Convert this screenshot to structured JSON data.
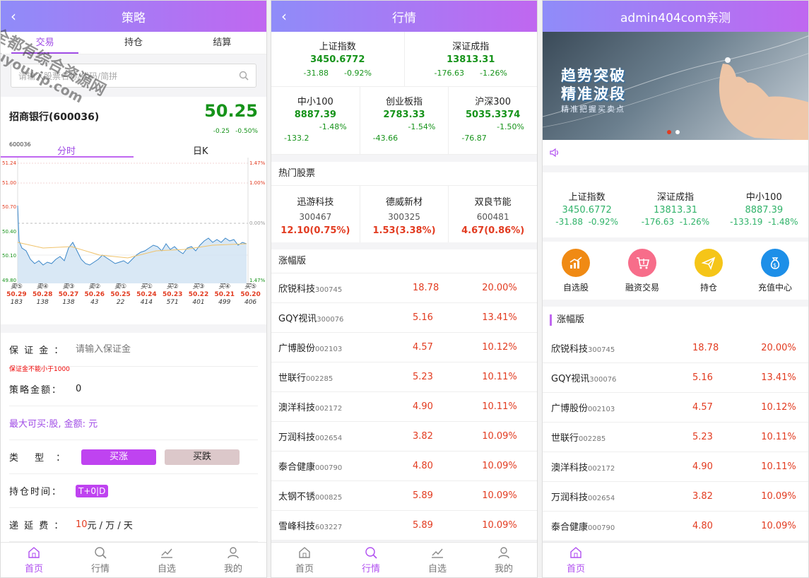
{
  "p1": {
    "title": "策略",
    "tabs": [
      "交易",
      "持仓",
      "结算"
    ],
    "search_placeholder": "请输入股票名称/代码/简拼",
    "stock": {
      "name": "招商银行(600036)",
      "price": "50.25",
      "change": "-0.25",
      "pct": "-0.50%",
      "code": "600036"
    },
    "subtabs": [
      "分时",
      "日K"
    ],
    "y_labels_left": [
      "51.24",
      "51.00",
      "50.70",
      "50.40",
      "50.10",
      "49.80"
    ],
    "y_labels_right": [
      "1.47%",
      "1.00%",
      "0.00%",
      "1.47%"
    ],
    "orders": [
      {
        "label": "卖⑤",
        "price": "50.29",
        "vol": "183"
      },
      {
        "label": "卖④",
        "price": "50.28",
        "vol": "138"
      },
      {
        "label": "卖③",
        "price": "50.27",
        "vol": "138"
      },
      {
        "label": "卖②",
        "price": "50.26",
        "vol": "43"
      },
      {
        "label": "卖①",
        "price": "50.25",
        "vol": "22"
      },
      {
        "label": "买①",
        "price": "50.24",
        "vol": "414"
      },
      {
        "label": "买②",
        "price": "50.23",
        "vol": "571"
      },
      {
        "label": "买③",
        "price": "50.22",
        "vol": "401"
      },
      {
        "label": "买④",
        "price": "50.21",
        "vol": "499"
      },
      {
        "label": "买⑤",
        "price": "50.20",
        "vol": "406"
      }
    ],
    "form": {
      "margin_label": "保 证 金 ：",
      "margin_placeholder": "请输入保证金",
      "margin_hint": "保证金不能小于1000",
      "amount_label": "策略金额：",
      "amount_value": "0",
      "max_buy": "最大可买:股, 金额: 元",
      "type_label": "类　 型　：",
      "btn_up": "买涨",
      "btn_down": "买跌",
      "hold_label": "持仓时间：",
      "hold_value": "T+0|D",
      "fee_label": "递 延 费 ：",
      "fee_value": "10",
      "fee_unit": "元 / 万 / 天"
    }
  },
  "p2": {
    "title": "行情",
    "indices_top": [
      {
        "name": "上证指数",
        "value": "3450.6772",
        "chg": "-31.88",
        "pct": "-0.92%"
      },
      {
        "name": "深证成指",
        "value": "13813.31",
        "chg": "-176.63",
        "pct": "-1.26%"
      }
    ],
    "indices_mid": [
      {
        "name": "中小100",
        "value": "8887.39",
        "pct": "-1.48%",
        "chg": "-133.2"
      },
      {
        "name": "创业板指",
        "value": "2783.33",
        "pct": "-1.54%",
        "chg": "-43.66"
      },
      {
        "name": "沪深300",
        "value": "5035.3374",
        "pct": "-1.50%",
        "chg": "-76.87"
      }
    ],
    "hot_title": "热门股票",
    "hot": [
      {
        "name": "迅游科技",
        "code": "300467",
        "val": "12.10(0.75%)"
      },
      {
        "name": "德威新材",
        "code": "300325",
        "val": "1.53(3.38%)"
      },
      {
        "name": "双良节能",
        "code": "600481",
        "val": "4.67(0.86%)"
      }
    ],
    "list_title": "涨幅版",
    "list": [
      {
        "name": "欣锐科技",
        "code": "300745",
        "price": "18.78",
        "pct": "20.00%"
      },
      {
        "name": "GQY视讯",
        "code": "300076",
        "price": "5.16",
        "pct": "13.41%"
      },
      {
        "name": "广博股份",
        "code": "002103",
        "price": "4.57",
        "pct": "10.12%"
      },
      {
        "name": "世联行",
        "code": "002285",
        "price": "5.23",
        "pct": "10.11%"
      },
      {
        "name": "澳洋科技",
        "code": "002172",
        "price": "4.90",
        "pct": "10.11%"
      },
      {
        "name": "万润科技",
        "code": "002654",
        "price": "3.82",
        "pct": "10.09%"
      },
      {
        "name": "泰合健康",
        "code": "000790",
        "price": "4.80",
        "pct": "10.09%"
      },
      {
        "name": "太钢不锈",
        "code": "000825",
        "price": "5.89",
        "pct": "10.09%"
      },
      {
        "name": "雪峰科技",
        "code": "603227",
        "price": "5.89",
        "pct": "10.09%"
      }
    ]
  },
  "p3": {
    "title": "admin404com亲测",
    "banner": {
      "line1": "趋势突破",
      "line2": "精准波段",
      "line3": "精准把握买卖点"
    },
    "indices": [
      {
        "name": "上证指数",
        "value": "3450.6772",
        "chg": "-31.88",
        "pct": "-0.92%"
      },
      {
        "name": "深证成指",
        "value": "13813.31",
        "chg": "-176.63",
        "pct": "-1.26%"
      },
      {
        "name": "中小100",
        "value": "8887.39",
        "chg": "-133.19",
        "pct": "-1.48%"
      }
    ],
    "icons": [
      {
        "label": "自选股",
        "color": "#f08a14"
      },
      {
        "label": "融资交易",
        "color": "#f76d8a"
      },
      {
        "label": "持仓",
        "color": "#f5c518"
      },
      {
        "label": "充值中心",
        "color": "#1d8fe8"
      }
    ],
    "list_title": "涨幅版",
    "list": [
      {
        "name": "欣锐科技",
        "code": "300745",
        "price": "18.78",
        "pct": "20.00%"
      },
      {
        "name": "GQY视讯",
        "code": "300076",
        "price": "5.16",
        "pct": "13.41%"
      },
      {
        "name": "广博股份",
        "code": "002103",
        "price": "4.57",
        "pct": "10.12%"
      },
      {
        "name": "世联行",
        "code": "002285",
        "price": "5.23",
        "pct": "10.11%"
      },
      {
        "name": "澳洋科技",
        "code": "002172",
        "price": "4.90",
        "pct": "10.11%"
      },
      {
        "name": "万润科技",
        "code": "002654",
        "price": "3.82",
        "pct": "10.09%"
      },
      {
        "name": "泰合健康",
        "code": "000790",
        "price": "4.80",
        "pct": "10.09%"
      }
    ]
  },
  "tabbar": [
    "首页",
    "行情",
    "自选",
    "我的"
  ],
  "watermark": [
    "全都有综合资源网",
    "douyouvip.com"
  ]
}
